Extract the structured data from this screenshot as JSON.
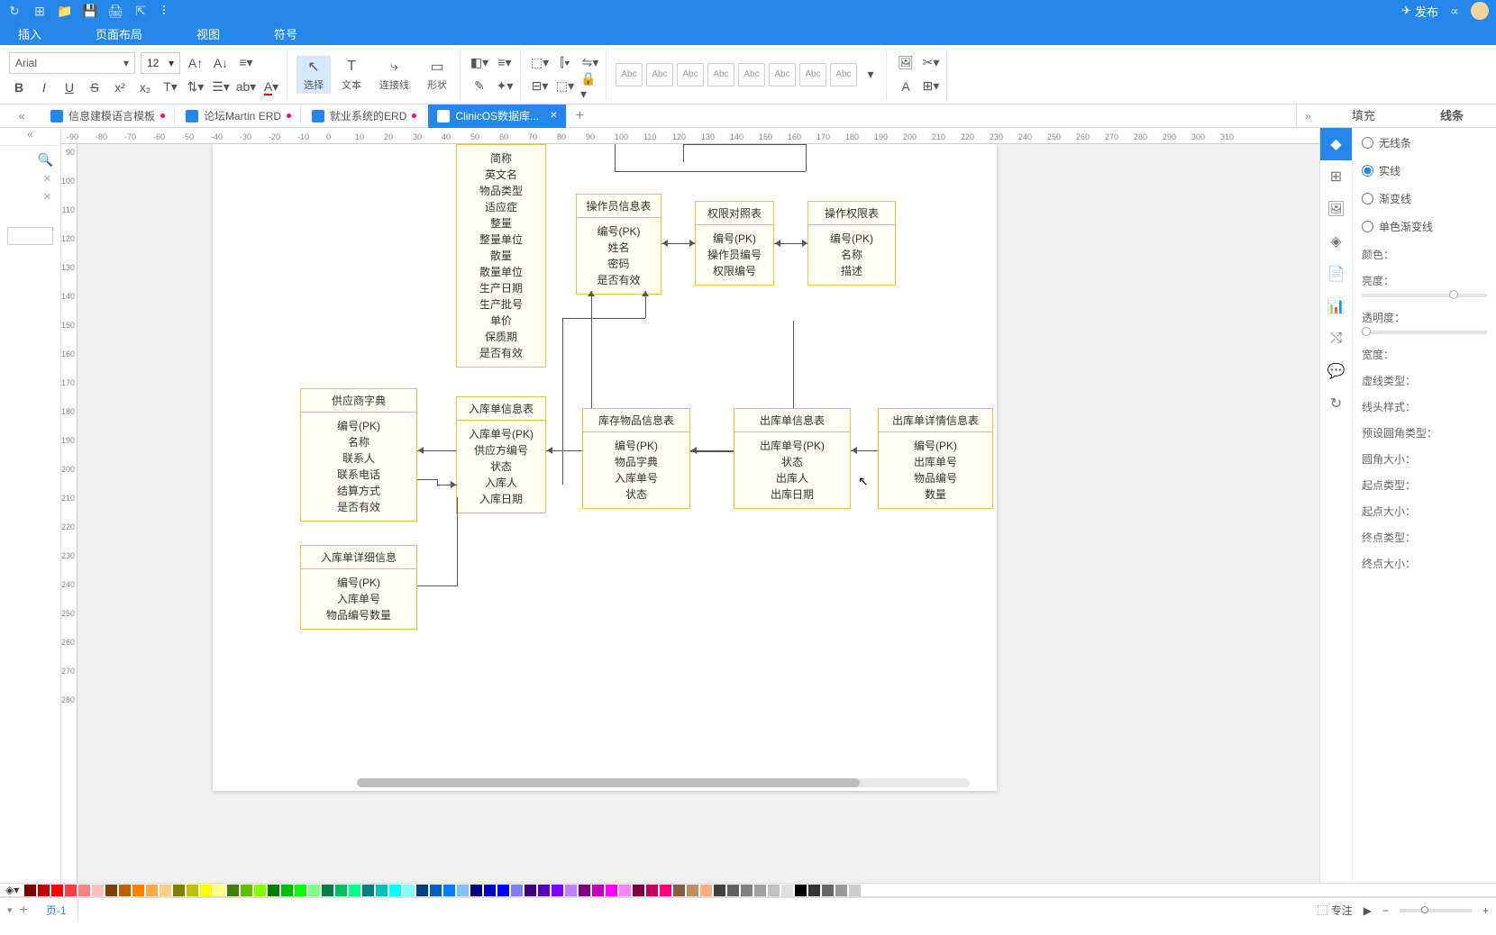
{
  "titlebar": {
    "publish": "发布"
  },
  "menu": [
    "插入",
    "页面布局",
    "视图",
    "符号"
  ],
  "toolbar": {
    "font": "Arial",
    "size": "12",
    "select": "选择",
    "text": "文本",
    "connector": "连接线",
    "shape": "形状",
    "swatch": "Abc"
  },
  "tabs": [
    {
      "label": "信息建模语言模板",
      "dirty": true
    },
    {
      "label": "论坛Martin ERD",
      "dirty": true
    },
    {
      "label": "就业系统的ERD",
      "dirty": true
    },
    {
      "label": "ClinicOS数据库...",
      "dirty": true,
      "active": true
    }
  ],
  "rightTabs": {
    "fill": "填充",
    "line": "线条"
  },
  "rightProps": {
    "none": "无线条",
    "solid": "实线",
    "grad": "渐变线",
    "mono": "单色渐变线",
    "color": "颜色：",
    "bright": "亮度：",
    "opacity": "透明度：",
    "width": "宽度：",
    "dash": "虚线类型：",
    "cap": "线头样式：",
    "corner": "预设圆角类型：",
    "cornerSize": "圆角大小：",
    "startType": "起点类型：",
    "startSize": "起点大小：",
    "endType": "终点类型：",
    "endSize": "终点大小："
  },
  "ruler_h": [
    "-90",
    "-80",
    "-70",
    "-60",
    "-50",
    "-40",
    "-30",
    "-20",
    "-10",
    "0",
    "10",
    "20",
    "30",
    "40",
    "50",
    "60",
    "70",
    "80",
    "90",
    "100",
    "110",
    "120",
    "130",
    "140",
    "150",
    "160",
    "170",
    "180",
    "190",
    "200",
    "210",
    "220",
    "230",
    "240",
    "250",
    "260",
    "270",
    "280",
    "290",
    "300",
    "310"
  ],
  "ruler_v": [
    "90",
    "100",
    "110",
    "120",
    "130",
    "140",
    "150",
    "160",
    "170",
    "180",
    "190",
    "200",
    "210",
    "220",
    "230",
    "240",
    "250",
    "260",
    "270",
    "280"
  ],
  "erd": {
    "goods": {
      "fields": [
        "简称",
        "英文名",
        "物品类型",
        "适应症",
        "整量",
        "整量单位",
        "散量",
        "散量单位",
        "生产日期",
        "生产批号",
        "单价",
        "保质期",
        "是否有效"
      ]
    },
    "operator": {
      "title": "操作员信息表",
      "fields": [
        "编号(PK)",
        "姓名",
        "密码",
        "是否有效"
      ]
    },
    "permMap": {
      "title": "权限对照表",
      "fields": [
        "编号(PK)",
        "操作员编号",
        "权限编号"
      ]
    },
    "perm": {
      "title": "操作权限表",
      "fields": [
        "编号(PK)",
        "名称",
        "描述"
      ]
    },
    "supplier": {
      "title": "供应商字典",
      "fields": [
        "编号(PK)",
        "名称",
        "联系人",
        "联系电话",
        "结算方式",
        "是否有效"
      ]
    },
    "inOrder": {
      "title": "入库单信息表",
      "fields": [
        "入库单号(PK)",
        "供应方编号",
        "状态",
        "入库人",
        "入库日期"
      ]
    },
    "stock": {
      "title": "库存物品信息表",
      "fields": [
        "编号(PK)",
        "物品字典",
        "入库单号",
        "状态"
      ]
    },
    "outOrder": {
      "title": "出库单信息表",
      "fields": [
        "出库单号(PK)",
        "状态",
        "出库人",
        "出库日期"
      ]
    },
    "outDetail": {
      "title": "出库单详情信息表",
      "fields": [
        "编号(PK)",
        "出库单号",
        "物品编号",
        "数量"
      ]
    },
    "inDetail": {
      "title": "入库单详细信息",
      "fields": [
        "编号(PK)",
        "入库单号",
        "物品编号数量"
      ]
    }
  },
  "status": {
    "page": "页-1",
    "focus": "专注"
  }
}
